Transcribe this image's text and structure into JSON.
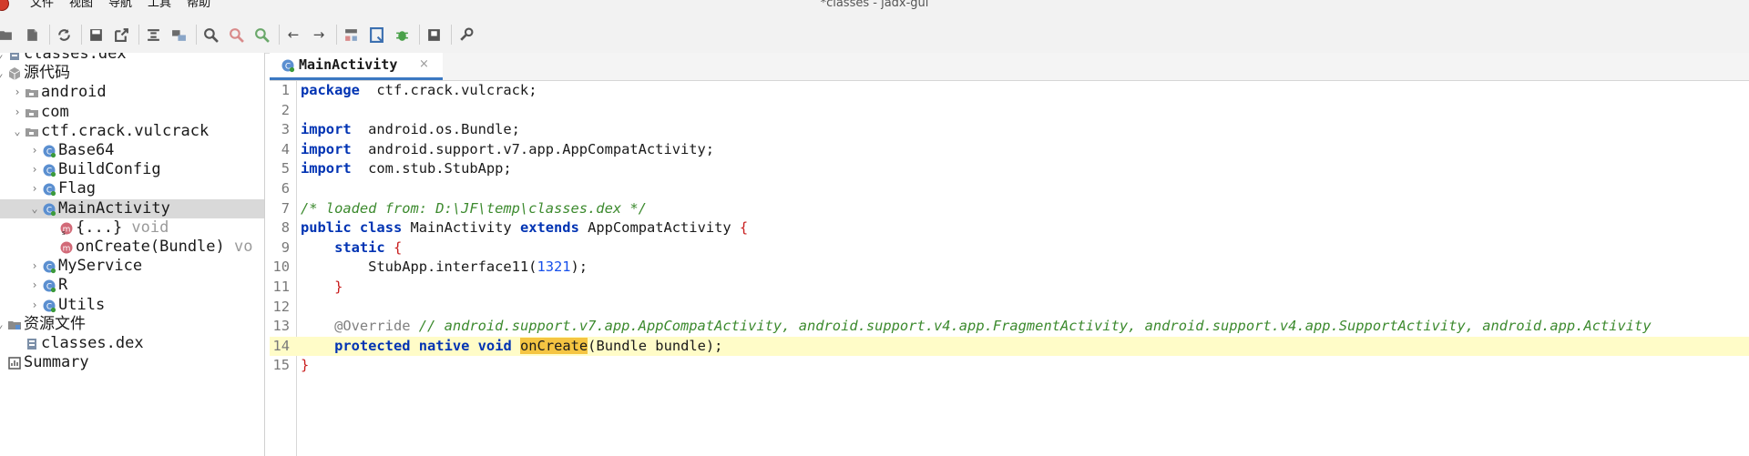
{
  "window": {
    "title": "*classes - jadx-gui"
  },
  "menu": [
    "文件",
    "视图",
    "导航",
    "工具",
    "帮助"
  ],
  "toolbar": {
    "buttons": [
      "open-icon",
      "add-files-icon",
      "sync-icon",
      "save-icon",
      "export-icon",
      "sync-tree-icon",
      "flatten-icon",
      "search-icon",
      "usage-icon",
      "search-text-icon",
      "back-icon",
      "forward-icon",
      "deobfuscation-icon",
      "log-icon",
      "debug-icon",
      "bookmark-icon",
      "preferences-icon"
    ]
  },
  "tree": {
    "items": [
      {
        "label": "classes.dex",
        "level": 0,
        "icon": "dex-file-icon",
        "arrow": "open"
      },
      {
        "label": "源代码",
        "level": 0,
        "icon": "source-root-icon",
        "arrow": "open"
      },
      {
        "label": "android",
        "level": 1,
        "icon": "package-icon",
        "arrow": "closed"
      },
      {
        "label": "com",
        "level": 1,
        "icon": "package-icon",
        "arrow": "closed"
      },
      {
        "label": "ctf.crack.vulcrack",
        "level": 1,
        "icon": "package-icon",
        "arrow": "open"
      },
      {
        "label": "Base64",
        "level": 2,
        "icon": "class-icon",
        "arrow": "closed"
      },
      {
        "label": "BuildConfig",
        "level": 2,
        "icon": "class-icon",
        "arrow": "closed"
      },
      {
        "label": "Flag",
        "level": 2,
        "icon": "class-icon",
        "arrow": "closed"
      },
      {
        "label": "MainActivity",
        "level": 2,
        "icon": "class-icon",
        "arrow": "open",
        "selected": true
      },
      {
        "label": "{...}",
        "sub": " void",
        "level": 3,
        "icon": "static-method-icon",
        "arrow": "none"
      },
      {
        "label": "onCreate(Bundle)",
        "sub": " vo",
        "level": 3,
        "icon": "method-icon",
        "arrow": "none"
      },
      {
        "label": "MyService",
        "level": 2,
        "icon": "class-icon",
        "arrow": "closed"
      },
      {
        "label": "R",
        "level": 2,
        "icon": "class-icon",
        "arrow": "closed"
      },
      {
        "label": "Utils",
        "level": 2,
        "icon": "class-icon",
        "arrow": "closed"
      },
      {
        "label": "资源文件",
        "level": 0,
        "icon": "resources-icon",
        "arrow": "open"
      },
      {
        "label": "classes.dex",
        "level": 1,
        "icon": "dex-file-icon",
        "arrow": "none"
      },
      {
        "label": "Summary",
        "level": 0,
        "icon": "summary-icon",
        "arrow": "none"
      }
    ]
  },
  "editor": {
    "tab": {
      "label": "MainActivity",
      "close": "×"
    },
    "lines": [
      {
        "n": "1",
        "tokens": [
          [
            "kw",
            "package"
          ],
          [
            "",
            "  ctf.crack.vulcrack;"
          ]
        ]
      },
      {
        "n": "2",
        "tokens": []
      },
      {
        "n": "3",
        "tokens": [
          [
            "kw",
            "import"
          ],
          [
            "",
            "  android.os.Bundle;"
          ]
        ]
      },
      {
        "n": "4",
        "tokens": [
          [
            "kw",
            "import"
          ],
          [
            "",
            "  android.support.v7.app.AppCompatActivity;"
          ]
        ]
      },
      {
        "n": "5",
        "tokens": [
          [
            "kw",
            "import"
          ],
          [
            "",
            "  com.stub.StubApp;"
          ]
        ]
      },
      {
        "n": "6",
        "tokens": []
      },
      {
        "n": "7",
        "tokens": [
          [
            "cm",
            "/* loaded from: D:\\JF\\temp\\classes.dex */"
          ]
        ]
      },
      {
        "n": "8",
        "tokens": [
          [
            "kw",
            "public"
          ],
          [
            "",
            " "
          ],
          [
            "kw",
            "class"
          ],
          [
            "",
            " MainActivity "
          ],
          [
            "kw",
            "extends"
          ],
          [
            "",
            " AppCompatActivity "
          ],
          [
            "br",
            "{"
          ]
        ]
      },
      {
        "n": "9",
        "tokens": [
          [
            "",
            "    "
          ],
          [
            "kw",
            "static"
          ],
          [
            "",
            " "
          ],
          [
            "br",
            "{"
          ]
        ]
      },
      {
        "n": "10",
        "tokens": [
          [
            "",
            "        StubApp.interface11("
          ],
          [
            "num",
            "1321"
          ],
          [
            "",
            ");"
          ]
        ]
      },
      {
        "n": "11",
        "tokens": [
          [
            "",
            "    "
          ],
          [
            "br",
            "}"
          ]
        ]
      },
      {
        "n": "12",
        "tokens": []
      },
      {
        "n": "13",
        "tokens": [
          [
            "",
            "    "
          ],
          [
            "an",
            "@Override"
          ],
          [
            "",
            " "
          ],
          [
            "cm",
            "// android.support.v7.app.AppCompatActivity, android.support.v4.app.FragmentActivity, android.support.v4.app.SupportActivity, android.app.Activity"
          ]
        ]
      },
      {
        "n": "14",
        "hl": true,
        "tokens": [
          [
            "",
            "    "
          ],
          [
            "kw",
            "protected"
          ],
          [
            "",
            " "
          ],
          [
            "kw",
            "native"
          ],
          [
            "",
            " "
          ],
          [
            "kw",
            "void"
          ],
          [
            "",
            " "
          ],
          [
            "mark",
            "onCre"
          ],
          [
            "caret",
            ""
          ],
          [
            "mark",
            "ate"
          ],
          [
            "",
            "(Bundle bundle);"
          ]
        ]
      },
      {
        "n": "15",
        "tokens": [
          [
            "br",
            "}"
          ]
        ]
      }
    ]
  },
  "colors": {
    "accent": "#3b78c2",
    "keyword": "#0033b3",
    "comment": "#3c8a2e",
    "highlight_line": "#fffcc8",
    "search_mark": "#f5c542"
  }
}
